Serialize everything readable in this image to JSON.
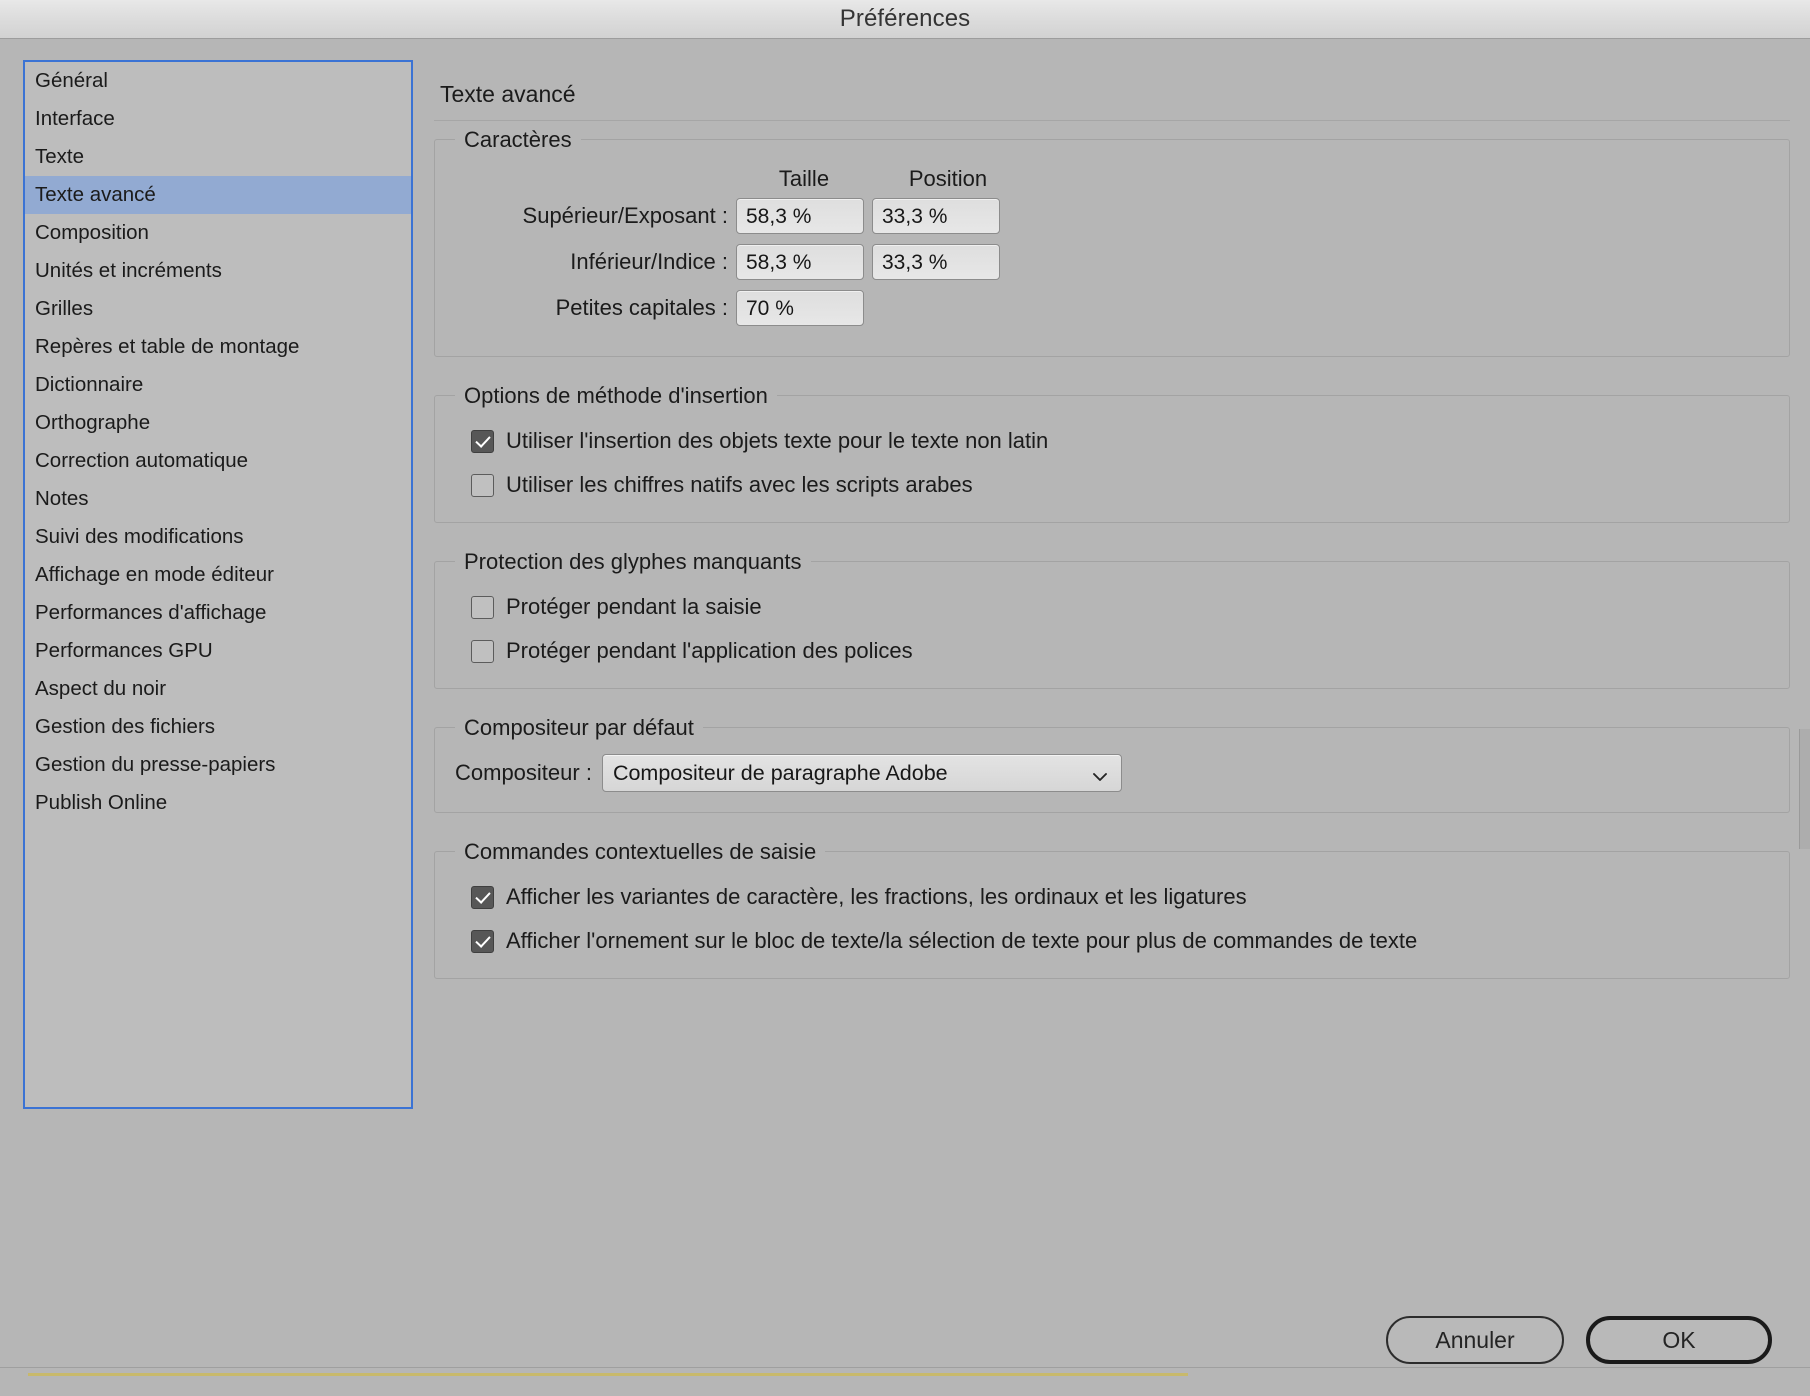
{
  "window": {
    "title": "Préférences"
  },
  "sidebar": {
    "items": [
      {
        "label": "Général",
        "selected": false
      },
      {
        "label": "Interface",
        "selected": false
      },
      {
        "label": "Texte",
        "selected": false
      },
      {
        "label": "Texte avancé",
        "selected": true
      },
      {
        "label": "Composition",
        "selected": false
      },
      {
        "label": "Unités et incréments",
        "selected": false
      },
      {
        "label": "Grilles",
        "selected": false
      },
      {
        "label": "Repères et table de montage",
        "selected": false
      },
      {
        "label": "Dictionnaire",
        "selected": false
      },
      {
        "label": "Orthographe",
        "selected": false
      },
      {
        "label": "Correction automatique",
        "selected": false
      },
      {
        "label": "Notes",
        "selected": false
      },
      {
        "label": "Suivi des modifications",
        "selected": false
      },
      {
        "label": "Affichage en mode éditeur",
        "selected": false
      },
      {
        "label": "Performances d'affichage",
        "selected": false
      },
      {
        "label": "Performances GPU",
        "selected": false
      },
      {
        "label": "Aspect du noir",
        "selected": false
      },
      {
        "label": "Gestion des fichiers",
        "selected": false
      },
      {
        "label": "Gestion du presse-papiers",
        "selected": false
      },
      {
        "label": "Publish Online",
        "selected": false
      }
    ]
  },
  "main": {
    "pane_title": "Texte avancé",
    "characters": {
      "legend": "Caractères",
      "col_size": "Taille",
      "col_position": "Position",
      "rows": [
        {
          "label": "Supérieur/Exposant :",
          "size": "58,3 %",
          "position": "33,3 %"
        },
        {
          "label": "Inférieur/Indice :",
          "size": "58,3 %",
          "position": "33,3 %"
        },
        {
          "label": "Petites capitales :",
          "size": "70 %",
          "position": null
        }
      ]
    },
    "input_method": {
      "legend": "Options de méthode d'insertion",
      "options": [
        {
          "label": "Utiliser l'insertion des objets texte pour le texte non latin",
          "checked": true
        },
        {
          "label": "Utiliser les chiffres natifs avec les scripts arabes",
          "checked": false
        }
      ]
    },
    "missing_glyph": {
      "legend": "Protection des glyphes manquants",
      "options": [
        {
          "label": "Protéger pendant la saisie",
          "checked": false
        },
        {
          "label": "Protéger pendant l'application des polices",
          "checked": false
        }
      ]
    },
    "composer": {
      "legend": "Compositeur par défaut",
      "field_label": "Compositeur :",
      "value": "Compositeur de paragraphe Adobe"
    },
    "contextual": {
      "legend": "Commandes contextuelles de saisie",
      "options": [
        {
          "label": "Afficher les variantes de caractère, les fractions, les ordinaux et les ligatures",
          "checked": true
        },
        {
          "label": "Afficher l'ornement sur le bloc de texte/la sélection de texte pour plus de commandes de texte",
          "checked": true
        }
      ]
    }
  },
  "footer": {
    "cancel_label": "Annuler",
    "ok_label": "OK"
  },
  "colors": {
    "dialog_background": "#b6b6b6",
    "selection_blue": "#92aad2",
    "focus_border": "#3b73d4",
    "checkbox_checked": "#575757"
  }
}
